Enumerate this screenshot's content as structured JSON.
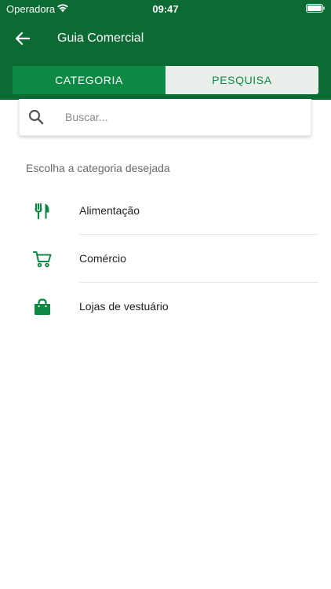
{
  "status_bar": {
    "carrier": "Operadora",
    "time": "09:47",
    "wifi_icon": "wifi-icon",
    "battery_icon": "battery-icon"
  },
  "header": {
    "title": "Guia Comercial",
    "back_icon": "arrow-left-icon"
  },
  "tabs": [
    {
      "label": "CATEGORIA",
      "active": true
    },
    {
      "label": "PESQUISA",
      "active": false
    }
  ],
  "search": {
    "placeholder": "Buscar...",
    "value": "",
    "icon": "search-icon"
  },
  "categories_heading": "Escolha a categoria desejada",
  "categories": [
    {
      "label": "Alimentação",
      "icon": "fork-knife-icon"
    },
    {
      "label": "Comércio",
      "icon": "shopping-cart-icon"
    },
    {
      "label": "Lojas de vestuário",
      "icon": "shopping-bag-icon"
    }
  ],
  "colors": {
    "header": "#0b6b32",
    "accent": "#0c8a43",
    "tab_inactive_bg": "#eaefeb"
  }
}
